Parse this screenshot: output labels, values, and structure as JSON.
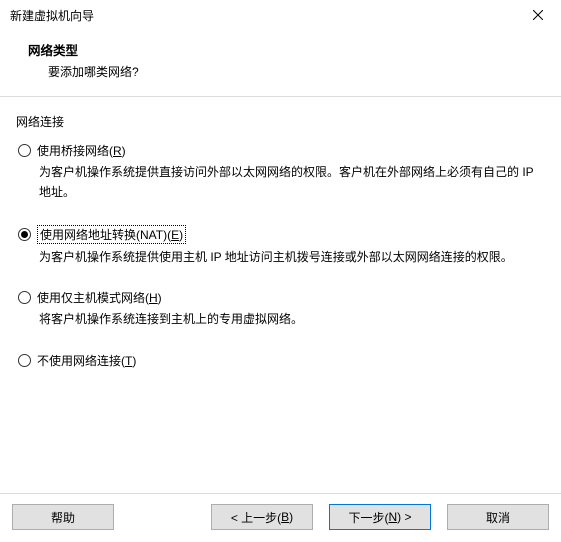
{
  "window": {
    "title": "新建虚拟机向导"
  },
  "header": {
    "title": "网络类型",
    "subtitle": "要添加哪类网络?"
  },
  "group": {
    "label": "网络连接"
  },
  "options": {
    "bridged": {
      "label_pre": "使用桥接网络(",
      "mnemonic": "R",
      "label_post": ")",
      "desc": "为客户机操作系统提供直接访问外部以太网网络的权限。客户机在外部网络上必须有自己的 IP 地址。"
    },
    "nat": {
      "label_pre": "使用网络地址转换(NAT)(",
      "mnemonic": "E",
      "label_post": ")",
      "desc": "为客户机操作系统提供使用主机 IP 地址访问主机拨号连接或外部以太网网络连接的权限。"
    },
    "hostonly": {
      "label_pre": "使用仅主机模式网络(",
      "mnemonic": "H",
      "label_post": ")",
      "desc": "将客户机操作系统连接到主机上的专用虚拟网络。"
    },
    "none": {
      "label_pre": "不使用网络连接(",
      "mnemonic": "T",
      "label_post": ")"
    }
  },
  "buttons": {
    "help": "帮助",
    "back_pre": "< 上一步(",
    "back_m": "B",
    "back_post": ")",
    "next_pre": "下一步(",
    "next_m": "N",
    "next_post": ") >",
    "cancel": "取消"
  },
  "state": {
    "selected": "nat"
  }
}
